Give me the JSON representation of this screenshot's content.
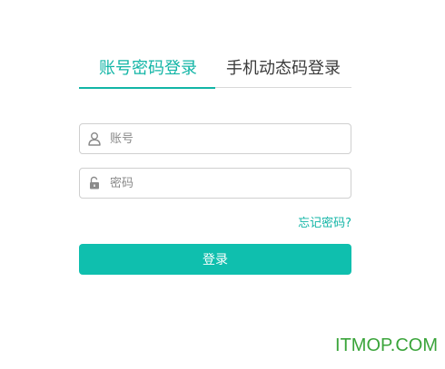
{
  "tabs": {
    "account_login": "账号密码登录",
    "sms_login": "手机动态码登录",
    "active": "account_login"
  },
  "form": {
    "username_value": "",
    "username_placeholder": "账号",
    "password_value": "",
    "password_placeholder": "密码",
    "forgot_password": "忘记密码?",
    "submit_label": "登录"
  },
  "watermark": "ITMOP.COM",
  "colors": {
    "accent": "#12b5a6",
    "button": "#0fbfae",
    "watermark": "#3aa43a"
  },
  "icons": {
    "username": "user-icon",
    "password": "lock-icon"
  }
}
